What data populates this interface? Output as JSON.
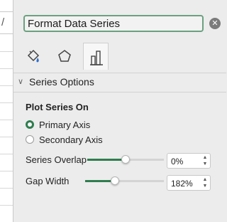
{
  "sheet": {
    "formula_glyph": "/"
  },
  "pane": {
    "title": "Format Data Series",
    "close_icon": "close-icon",
    "tabs": [
      {
        "name": "fill-line",
        "icon": "paint-bucket-icon",
        "active": false
      },
      {
        "name": "effects",
        "icon": "pentagon-icon",
        "active": false
      },
      {
        "name": "series-options",
        "icon": "bar-chart-icon",
        "active": true
      }
    ],
    "section_label": "Series Options",
    "plot_series_on": "Plot Series On",
    "radios": [
      {
        "label": "Primary Axis",
        "selected": true
      },
      {
        "label": "Secondary Axis",
        "selected": false
      }
    ],
    "series_overlap": {
      "label": "Series Overlap",
      "value": "0%",
      "level": 0.5
    },
    "gap_width": {
      "label": "Gap Width",
      "value": "182%",
      "level": 0.36
    },
    "accent": "#2f7d4e"
  }
}
